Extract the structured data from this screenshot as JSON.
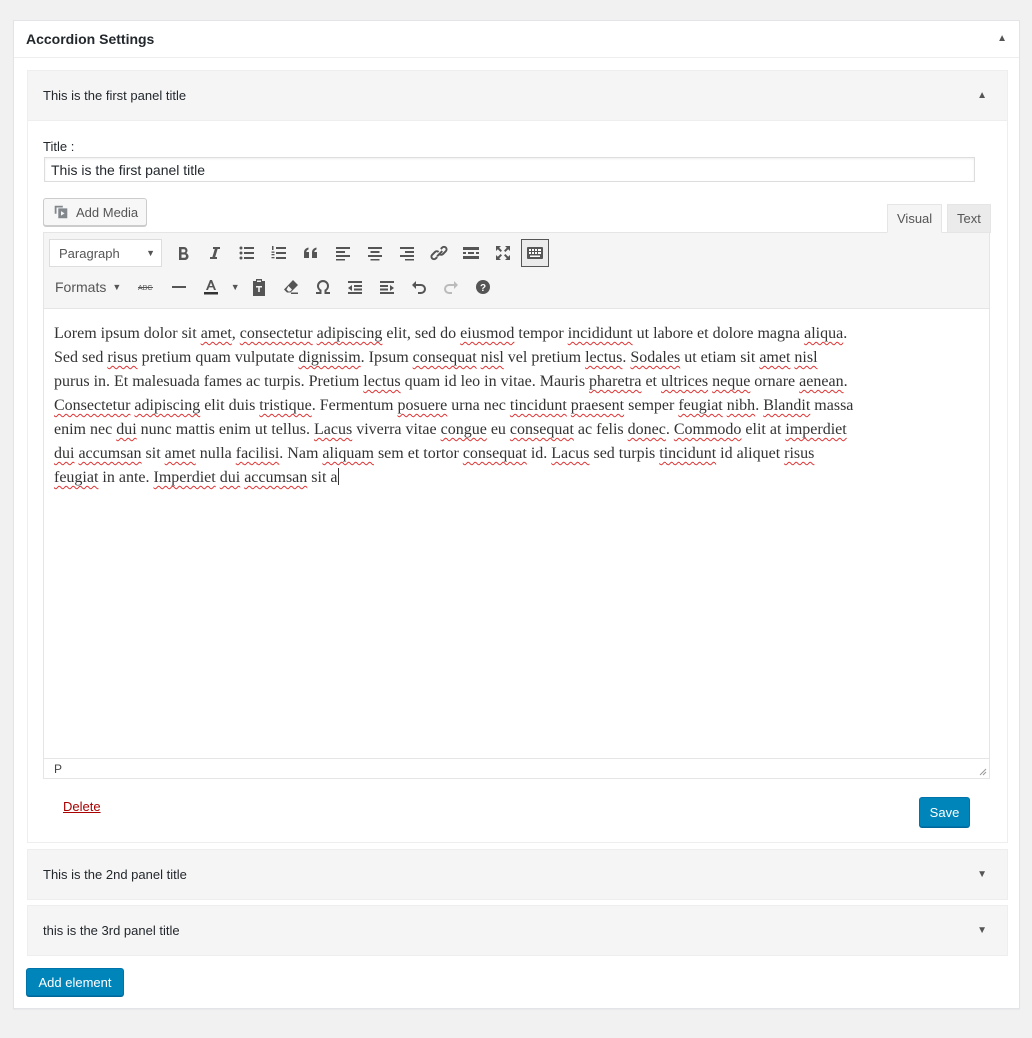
{
  "metabox": {
    "title": "Accordion Settings"
  },
  "panels": [
    {
      "title": "This is the first panel title",
      "title_label": "Title :",
      "title_value": "This is the first panel title",
      "add_media_label": "Add Media",
      "tabs": {
        "visual": "Visual",
        "text": "Text"
      },
      "format_select": "Paragraph",
      "formats_label": "Formats",
      "content": "Lorem ipsum dolor sit amet, consectetur adipiscing elit, sed do eiusmod tempor incididunt ut labore et dolore magna aliqua. Sed sed risus pretium quam vulputate dignissim. Ipsum consequat nisl vel pretium lectus. Sodales ut etiam sit amet nisl purus in. Et malesuada fames ac turpis. Pretium lectus quam id leo in vitae. Mauris pharetra et ultrices neque ornare aenean. Consectetur adipiscing elit duis tristique. Fermentum posuere urna nec tincidunt praesent semper feugiat nibh. Blandit massa enim nec dui nunc mattis enim ut tellus. Lacus viverra vitae congue eu consequat ac felis donec. Commodo elit at imperdiet dui accumsan sit amet nulla facilisi. Nam aliquam sem et tortor consequat id. Lacus sed turpis tincidunt id aliquet risus feugiat in ante. Imperdiet dui accumsan sit a",
      "status_path": "P",
      "delete_label": "Delete",
      "save_label": "Save"
    },
    {
      "title": "This is the 2nd panel title"
    },
    {
      "title": "this is the 3rd panel title"
    }
  ],
  "add_element_label": "Add element",
  "colors": {
    "primary_button": "#0085ba",
    "delete_link": "#aa0000",
    "misspelling": "#dd3333"
  },
  "icons": [
    "triangle-up-icon",
    "triangle-down-icon",
    "media-icon",
    "bold-icon",
    "italic-icon",
    "bullet-list-icon",
    "numbered-list-icon",
    "blockquote-icon",
    "align-left-icon",
    "align-center-icon",
    "align-right-icon",
    "link-icon",
    "read-more-icon",
    "fullscreen-icon",
    "toolbar-toggle-icon",
    "strikethrough-icon",
    "horizontal-line-icon",
    "text-color-icon",
    "paste-text-icon",
    "clear-formatting-icon",
    "special-character-icon",
    "outdent-icon",
    "indent-icon",
    "undo-icon",
    "redo-icon",
    "help-icon"
  ]
}
